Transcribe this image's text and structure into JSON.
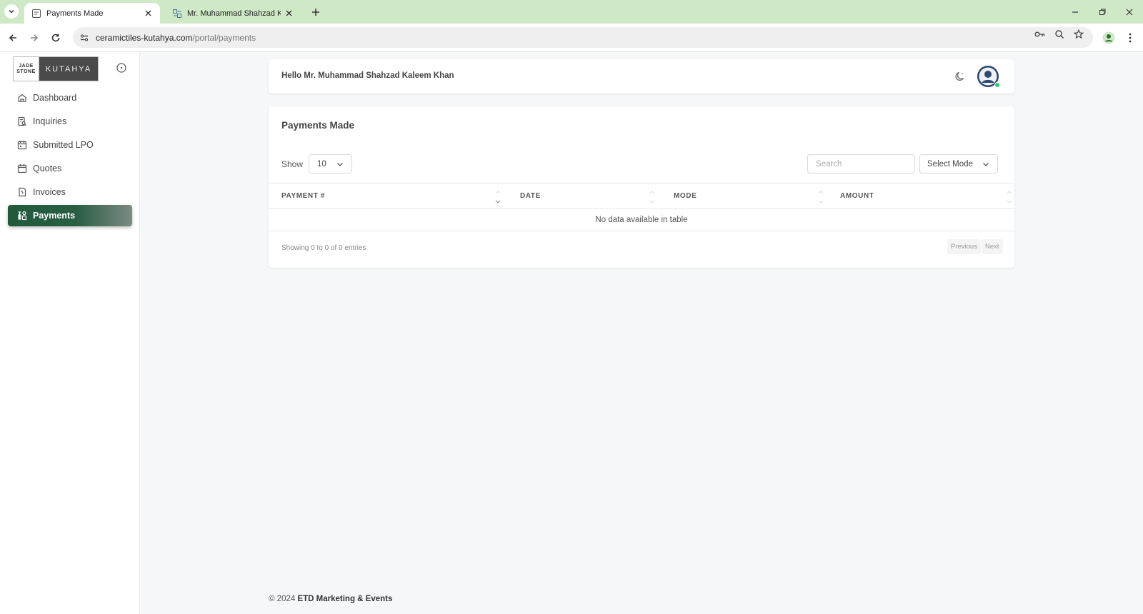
{
  "browser": {
    "tabs": [
      {
        "title": "Payments Made",
        "active": true
      },
      {
        "title": "Mr. Muhammad Shahzad Kaleem",
        "active": false
      }
    ],
    "url_domain": "ceramictiles-kutahya.com",
    "url_path": "/portal/payments"
  },
  "logo": {
    "left_line1": "JADE",
    "left_line2": "STONE",
    "right_text": "KUTAHYA"
  },
  "sidebar": {
    "items": [
      {
        "label": "Dashboard",
        "icon": "home-icon",
        "active": false
      },
      {
        "label": "Inquiries",
        "icon": "inquiry-icon",
        "active": false
      },
      {
        "label": "Submitted LPO",
        "icon": "calendar-icon",
        "active": false
      },
      {
        "label": "Quotes",
        "icon": "calendar-icon",
        "active": false
      },
      {
        "label": "Invoices",
        "icon": "invoice-icon",
        "active": false
      },
      {
        "label": "Payments",
        "icon": "payments-icon",
        "active": true
      }
    ]
  },
  "header": {
    "greeting": "Hello Mr. Muhammad Shahzad Kaleem Khan"
  },
  "card": {
    "title": "Payments Made",
    "show_label": "Show",
    "page_length": "10",
    "search_placeholder": "Search",
    "mode_select": "Select Mode",
    "columns": [
      "PAYMENT #",
      "DATE",
      "MODE",
      "AMOUNT"
    ],
    "empty_message": "No data available in table",
    "info": "Showing 0 to 0 of 0 entries",
    "prev_label": "Previous",
    "next_label": "Next"
  },
  "footer": {
    "prefix": "© 2024",
    "company": "ETD Marketing & Events"
  },
  "colors": {
    "tabbar": "#cfe9c6",
    "active_nav": "#1f5a3b",
    "online_dot": "#2ecc71"
  }
}
